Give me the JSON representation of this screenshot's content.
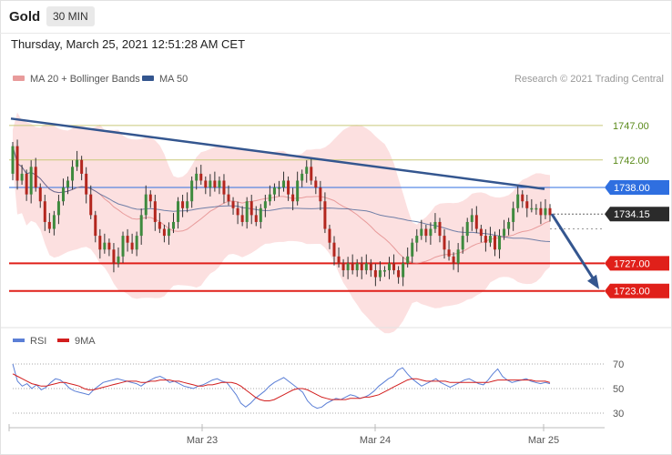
{
  "header": {
    "instrument": "Gold",
    "timeframe": "30 MIN"
  },
  "datetime": "Thursday, March 25, 2021 12:51:28 AM CET",
  "legend": {
    "ma20": "MA 20 + Bollinger Bands",
    "ma50": "MA 50"
  },
  "copyright": "Research © 2021 Trading Central",
  "colors": {
    "resistance": "#e0201a",
    "support_label": "#e0201a",
    "ma50": "#34568f",
    "ma20": "#e89b9b",
    "band_fill": "#fbdada",
    "candle_up": "#3e8a3e",
    "candle_down": "#b3261e",
    "pivot_blue": "#2f6fe0",
    "rsi": "#5b7fd6",
    "rsi_ma": "#d21e1e",
    "price_tag": "#2b2b2b"
  },
  "chart_data": [
    {
      "type": "candlestick",
      "ylim": [
        1719,
        1752
      ],
      "x_ticks": [
        "Mar 23",
        "Mar 24",
        "Mar 25"
      ],
      "levels": [
        {
          "value": "1747.00",
          "kind": "resistance-olive"
        },
        {
          "value": "1742.00",
          "kind": "resistance-olive"
        },
        {
          "value": "1738.00",
          "kind": "pivot"
        },
        {
          "value": "1734.15",
          "kind": "last-price"
        },
        {
          "value": "1727.00",
          "kind": "support"
        },
        {
          "value": "1723.00",
          "kind": "support"
        }
      ],
      "trendline": {
        "from": 1748.0,
        "to": 1737.8
      },
      "forecast_arrow": {
        "from": 1734.15,
        "to": 1723.0
      },
      "ohlc_close": [
        1744,
        1739,
        1740,
        1737,
        1741,
        1738,
        1736,
        1733,
        1732,
        1734,
        1736,
        1738,
        1739,
        1741,
        1742,
        1740,
        1737,
        1734,
        1731,
        1729,
        1730,
        1729,
        1727,
        1728,
        1731,
        1730,
        1729,
        1731,
        1734,
        1737,
        1736,
        1733,
        1732,
        1731,
        1732,
        1733,
        1736,
        1735,
        1736,
        1739,
        1740,
        1739,
        1738,
        1739,
        1738,
        1739,
        1737,
        1736,
        1735,
        1734,
        1733,
        1736,
        1734,
        1733,
        1735,
        1736,
        1737,
        1738,
        1738,
        1739,
        1737,
        1736,
        1739,
        1740,
        1741,
        1739,
        1738,
        1736,
        1732,
        1730,
        1728,
        1727,
        1726,
        1727,
        1726,
        1727,
        1726,
        1727,
        1726,
        1725,
        1726,
        1726,
        1727,
        1726,
        1725,
        1727,
        1728,
        1730,
        1731,
        1732,
        1731,
        1732,
        1733,
        1731,
        1729,
        1728,
        1727,
        1729,
        1731,
        1733,
        1734,
        1732,
        1731,
        1730,
        1731,
        1729,
        1731,
        1732,
        1733,
        1735,
        1737,
        1736,
        1735,
        1735,
        1735,
        1734,
        1735,
        1734
      ],
      "ohlc_open": [
        1740,
        1744,
        1739,
        1740,
        1737,
        1741,
        1738,
        1736,
        1733,
        1732,
        1734,
        1736,
        1738,
        1739,
        1741,
        1742,
        1740,
        1737,
        1734,
        1731,
        1729,
        1730,
        1729,
        1727,
        1728,
        1731,
        1730,
        1729,
        1731,
        1734,
        1737,
        1736,
        1733,
        1732,
        1731,
        1732,
        1733,
        1736,
        1735,
        1736,
        1739,
        1740,
        1739,
        1738,
        1739,
        1738,
        1739,
        1737,
        1736,
        1735,
        1734,
        1733,
        1736,
        1734,
        1733,
        1735,
        1736,
        1737,
        1738,
        1738,
        1739,
        1737,
        1736,
        1739,
        1740,
        1741,
        1739,
        1738,
        1736,
        1732,
        1730,
        1728,
        1727,
        1726,
        1727,
        1726,
        1727,
        1726,
        1727,
        1726,
        1725,
        1726,
        1726,
        1727,
        1726,
        1725,
        1727,
        1728,
        1730,
        1731,
        1732,
        1731,
        1732,
        1733,
        1731,
        1729,
        1728,
        1727,
        1729,
        1731,
        1733,
        1734,
        1732,
        1731,
        1730,
        1731,
        1729,
        1731,
        1732,
        1733,
        1735,
        1737,
        1736,
        1735,
        1735,
        1735,
        1734,
        1735
      ]
    },
    {
      "type": "line",
      "legend": {
        "rsi": "RSI",
        "ma": "9MA"
      },
      "ylim": [
        20,
        80
      ],
      "y_ticks": [
        "70",
        "50",
        "30"
      ],
      "rsi": [
        70,
        56,
        52,
        54,
        50,
        53,
        49,
        51,
        55,
        58,
        57,
        54,
        50,
        48,
        47,
        46,
        45,
        49,
        52,
        55,
        56,
        57,
        58,
        57,
        56,
        55,
        54,
        52,
        55,
        57,
        59,
        60,
        58,
        55,
        56,
        54,
        52,
        51,
        50,
        52,
        53,
        55,
        57,
        58,
        56,
        55,
        50,
        45,
        38,
        35,
        38,
        42,
        45,
        48,
        52,
        55,
        57,
        59,
        56,
        53,
        50,
        47,
        40,
        36,
        34,
        35,
        38,
        40,
        42,
        41,
        43,
        45,
        44,
        42,
        43,
        45,
        48,
        52,
        55,
        58,
        60,
        65,
        67,
        62,
        58,
        55,
        52,
        54,
        56,
        58,
        55,
        53,
        51,
        53,
        55,
        57,
        58,
        56,
        54,
        53,
        57,
        62,
        66,
        60,
        57,
        55,
        56,
        57,
        58,
        56,
        55,
        54,
        55,
        54
      ],
      "rsi_ma": [
        62,
        60,
        58,
        56,
        54,
        53,
        52,
        52,
        53,
        54,
        55,
        55,
        54,
        53,
        52,
        50,
        49,
        49,
        50,
        51,
        52,
        53,
        54,
        55,
        56,
        56,
        56,
        55,
        55,
        56,
        56,
        57,
        57,
        57,
        56,
        56,
        55,
        54,
        53,
        52,
        52,
        53,
        53,
        54,
        55,
        55,
        55,
        54,
        52,
        49,
        46,
        43,
        41,
        40,
        40,
        41,
        43,
        45,
        47,
        49,
        50,
        50,
        49,
        47,
        45,
        43,
        42,
        41,
        41,
        41,
        41,
        42,
        42,
        42,
        43,
        43,
        44,
        45,
        47,
        49,
        51,
        53,
        55,
        57,
        58,
        58,
        57,
        56,
        56,
        56,
        56,
        56,
        55,
        55,
        55,
        55,
        55,
        55,
        55,
        55,
        55,
        56,
        57,
        57,
        57,
        57,
        57,
        57,
        57,
        57,
        56,
        56,
        56,
        55
      ]
    }
  ]
}
